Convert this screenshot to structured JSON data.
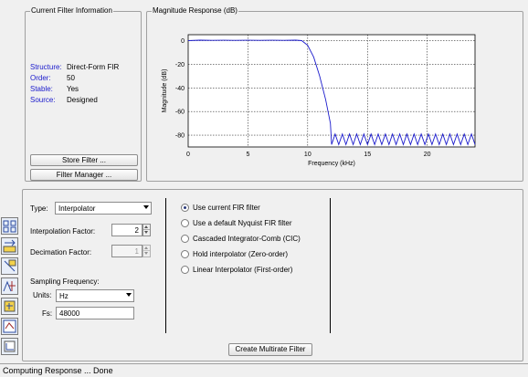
{
  "current_filter": {
    "legend": "Current Filter Information",
    "rows": [
      {
        "key": "Structure:",
        "value": "Direct-Form FIR"
      },
      {
        "key": "Order:",
        "value": "50"
      },
      {
        "key": "Stable:",
        "value": "Yes"
      },
      {
        "key": "Source:",
        "value": "Designed"
      }
    ],
    "store_button": "Store Filter ...",
    "manager_button": "Filter Manager ..."
  },
  "magnitude": {
    "legend": "Magnitude Response (dB)"
  },
  "chart_data": {
    "type": "line",
    "title": "",
    "xlabel": "Frequency (kHz)",
    "ylabel": "Magnitude (dB)",
    "xlim": [
      0,
      24
    ],
    "ylim": [
      -90,
      5
    ],
    "x_ticks": [
      "0",
      "5",
      "10",
      "15",
      "20"
    ],
    "y_ticks": [
      "0",
      "-20",
      "-40",
      "-60",
      "-80"
    ],
    "grid": true,
    "line_color": "#1a1acc",
    "series": [
      {
        "values": [
          [
            0,
            0
          ],
          [
            1,
            0.4
          ],
          [
            2,
            0.2
          ],
          [
            3,
            0.3
          ],
          [
            4,
            0.2
          ],
          [
            5,
            0.3
          ],
          [
            6,
            0.2
          ],
          [
            7,
            0.3
          ],
          [
            8,
            0.2
          ],
          [
            9,
            0.4
          ],
          [
            9.5,
            0
          ],
          [
            10,
            -4
          ],
          [
            10.5,
            -14
          ],
          [
            11,
            -30
          ],
          [
            11.5,
            -50
          ],
          [
            11.9,
            -70
          ],
          [
            12,
            -88
          ],
          [
            12.3,
            -79
          ],
          [
            12.6,
            -88
          ],
          [
            12.9,
            -79
          ],
          [
            13.2,
            -88
          ],
          [
            13.5,
            -79
          ],
          [
            13.8,
            -88
          ],
          [
            14.1,
            -79
          ],
          [
            14.4,
            -88
          ],
          [
            14.7,
            -79
          ],
          [
            15.0,
            -88
          ],
          [
            15.3,
            -79
          ],
          [
            15.6,
            -88
          ],
          [
            15.9,
            -79
          ],
          [
            16.2,
            -88
          ],
          [
            16.5,
            -79
          ],
          [
            16.8,
            -88
          ],
          [
            17.1,
            -79
          ],
          [
            17.4,
            -88
          ],
          [
            17.7,
            -79
          ],
          [
            18.0,
            -88
          ],
          [
            18.3,
            -79
          ],
          [
            18.6,
            -88
          ],
          [
            18.9,
            -79
          ],
          [
            19.2,
            -88
          ],
          [
            19.5,
            -79
          ],
          [
            19.8,
            -88
          ],
          [
            20.1,
            -79
          ],
          [
            20.4,
            -88
          ],
          [
            20.7,
            -79
          ],
          [
            21.0,
            -88
          ],
          [
            21.3,
            -79
          ],
          [
            21.6,
            -88
          ],
          [
            21.9,
            -79
          ],
          [
            22.2,
            -88
          ],
          [
            22.5,
            -79
          ],
          [
            22.8,
            -88
          ],
          [
            23.1,
            -79
          ],
          [
            23.4,
            -88
          ],
          [
            23.7,
            -79
          ],
          [
            24,
            -88
          ]
        ]
      }
    ]
  },
  "settings": {
    "type_label": "Type:",
    "type_value": "Interpolator",
    "interp_label": "Interpolation Factor:",
    "interp_value": "2",
    "decim_label": "Decimation Factor:",
    "decim_value": "1",
    "sampling_label": "Sampling Frequency:",
    "units_label": "Units:",
    "units_value": "Hz",
    "fs_label": "Fs:",
    "fs_value": "48000"
  },
  "options": [
    {
      "label": "Use current FIR filter",
      "selected": true
    },
    {
      "label": "Use a default Nyquist FIR filter",
      "selected": false
    },
    {
      "label": "Cascaded Integrator-Comb (CIC)",
      "selected": false
    },
    {
      "label": "Hold interpolator (Zero-order)",
      "selected": false
    },
    {
      "label": "Linear Interpolator (First-order)",
      "selected": false
    }
  ],
  "create_button": "Create Multirate Filter",
  "status": "Computing Response ... Done",
  "sidebar_icons": [
    "design-filter-icon",
    "transform-icon",
    "pole-zero-icon",
    "multirate-icon",
    "quantize-icon",
    "realize-model-icon",
    "import-icon"
  ]
}
